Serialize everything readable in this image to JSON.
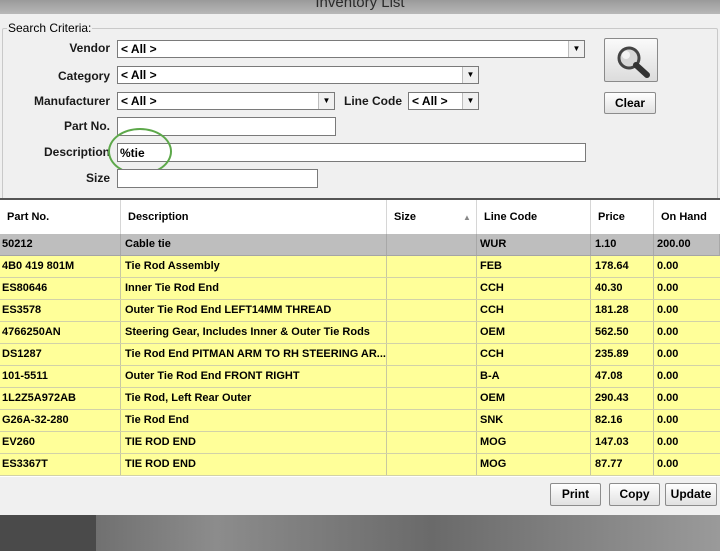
{
  "window": {
    "title": "Inventory List"
  },
  "search": {
    "group_label": "Search Criteria:",
    "vendor_label": "Vendor",
    "vendor_value": "< All >",
    "category_label": "Category",
    "category_value": "< All >",
    "manufacturer_label": "Manufacturer",
    "manufacturer_value": "< All >",
    "line_code_label": "Line Code",
    "line_code_value": "< All >",
    "part_no_label": "Part No.",
    "part_no_value": "",
    "description_label": "Description",
    "description_value": "%tie",
    "size_label": "Size",
    "size_value": "",
    "search_icon": "magnifier-icon",
    "clear_label": "Clear"
  },
  "grid": {
    "columns": [
      "Part No.",
      "Description",
      "Size",
      "Line Code",
      "Price",
      "On Hand"
    ],
    "sorted_column": "Size",
    "rows": [
      {
        "part_no": "50212",
        "description": "Cable tie",
        "size": "",
        "line_code": "WUR",
        "price": "1.10",
        "on_hand": "200.00"
      },
      {
        "part_no": "4B0 419 801M",
        "description": "Tie Rod Assembly",
        "size": "",
        "line_code": "FEB",
        "price": "178.64",
        "on_hand": "0.00"
      },
      {
        "part_no": "ES80646",
        "description": "Inner Tie Rod End",
        "size": "",
        "line_code": "CCH",
        "price": "40.30",
        "on_hand": "0.00"
      },
      {
        "part_no": "ES3578",
        "description": "Outer Tie Rod End LEFT14MM THREAD",
        "size": "",
        "line_code": "CCH",
        "price": "181.28",
        "on_hand": "0.00"
      },
      {
        "part_no": "4766250AN",
        "description": "Steering Gear, Includes Inner & Outer Tie Rods",
        "size": "",
        "line_code": "OEM",
        "price": "562.50",
        "on_hand": "0.00"
      },
      {
        "part_no": "DS1287",
        "description": "Tie Rod End PITMAN ARM TO RH STEERING AR...",
        "size": "",
        "line_code": "CCH",
        "price": "235.89",
        "on_hand": "0.00"
      },
      {
        "part_no": "101-5511",
        "description": "Outer Tie Rod End FRONT RIGHT",
        "size": "",
        "line_code": "B-A",
        "price": "47.08",
        "on_hand": "0.00"
      },
      {
        "part_no": "1L2Z5A972AB",
        "description": "Tie Rod, Left Rear Outer",
        "size": "",
        "line_code": "OEM",
        "price": "290.43",
        "on_hand": "0.00"
      },
      {
        "part_no": "G26A-32-280",
        "description": "Tie Rod End",
        "size": "",
        "line_code": "SNK",
        "price": "82.16",
        "on_hand": "0.00"
      },
      {
        "part_no": "EV260",
        "description": "TIE ROD END",
        "size": "",
        "line_code": "MOG",
        "price": "147.03",
        "on_hand": "0.00"
      },
      {
        "part_no": "ES3367T",
        "description": "TIE ROD END",
        "size": "",
        "line_code": "MOG",
        "price": "87.77",
        "on_hand": "0.00"
      }
    ]
  },
  "actions": {
    "print_label": "Print",
    "copy_label": "Copy",
    "update_label": "Update"
  },
  "colors": {
    "row_bg": "#ffff99",
    "selected_row_bg": "#bebebe",
    "highlight_circle": "#5da84a"
  }
}
